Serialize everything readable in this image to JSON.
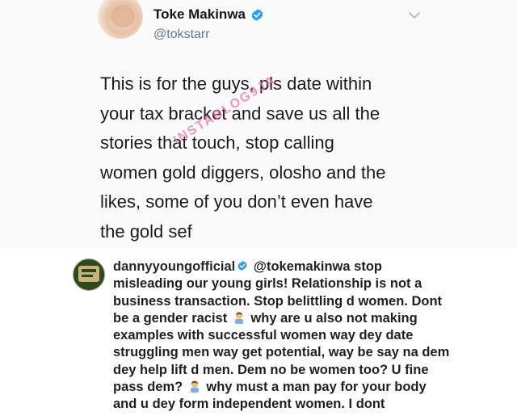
{
  "tweet": {
    "display_name": "Toke Makinwa",
    "handle": "@tokstarr",
    "text": "This is for the guys, pls date within\nyour tax bracket and save us all the\nstories that touch, stop calling\nwomen gold diggers, olosho and the\nlikes, some of you don’t even have\nthe gold sef",
    "watermark": "INSTABLOG9JA"
  },
  "comment": {
    "username": "dannyyoungofficial",
    "mention": "@tokemakinwa",
    "part1": " stop misleading our young girls! Relationship is not a business transaction. Stop belittling d women. Dont be a gender racist",
    "part2": " why are u also not making examples with successful women way dey date struggling men way get potential, way be say na dem dey help lift d men. Dem no be women too? U fine pass dem?",
    "part3": " why must a man pay for your body and u dey form independent women. I dont"
  },
  "icons": {
    "verified": "verified-badge-icon",
    "chevron": "chevron-down-icon",
    "emoji": "man-facepalming-emoji-icon"
  },
  "colors": {
    "verified_blue": "#1da1f2",
    "instagram_verified": "#3897f0",
    "watermark_pink": "#f06aa6"
  }
}
